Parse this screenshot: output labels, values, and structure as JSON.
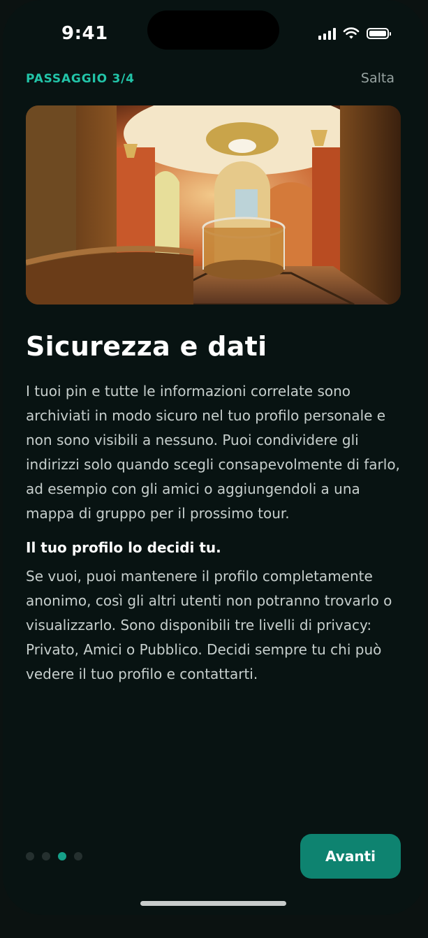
{
  "status_bar": {
    "time": "9:41",
    "icons": [
      "signal-icon",
      "wifi-icon",
      "battery-icon"
    ]
  },
  "header": {
    "step": "PASSAGGIO 3/4",
    "skip_label": "Salta"
  },
  "hero_image": {
    "description_icon": "hero-image"
  },
  "content": {
    "title": "Sicurezza e dati",
    "paragraph1": "I tuoi pin e tutte le informazioni correlate sono archiviati in modo sicuro nel tuo profilo personale e non sono visibili a nessuno. Puoi condividere gli indirizzi solo quando scegli consapevolmente di farlo, ad esempio con gli amici o aggiungendoli a una mappa di gruppo per il prossimo tour.",
    "subheading": "Il tuo profilo lo decidi tu.",
    "paragraph2": "Se vuoi, puoi mantenere il profilo completamente anonimo, così gli altri utenti non potranno trovarlo o visualizzarlo. Sono disponibili tre livelli di privacy: Privato, Amici o Pubblico. Decidi sempre tu chi può vedere il tuo profilo e contattarti."
  },
  "footer": {
    "page_count": 4,
    "current_page": 3,
    "next_label": "Avanti"
  },
  "colors": {
    "accent": "#22c4a8",
    "button": "#0e8370",
    "background": "#081312"
  }
}
